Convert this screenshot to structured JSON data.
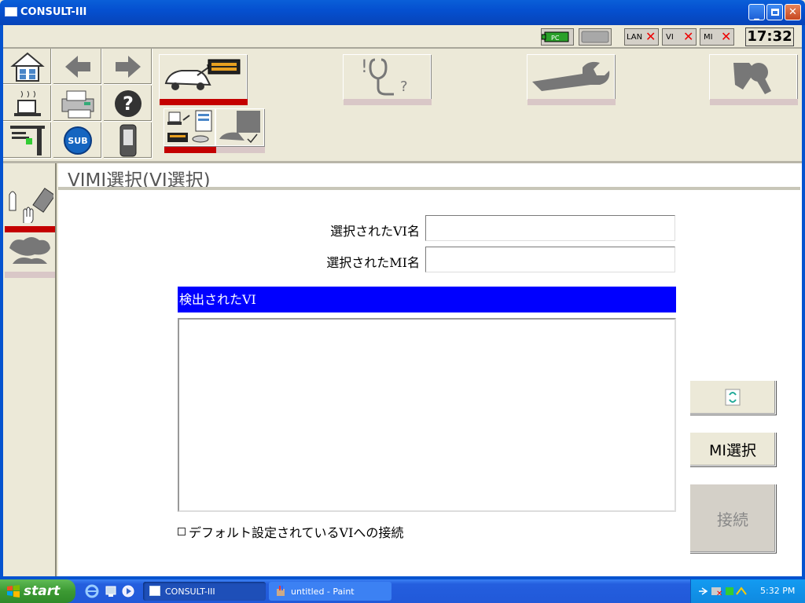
{
  "window": {
    "title": "CONSULT-III"
  },
  "status": {
    "pc_label": "PC",
    "lan_label": "LAN",
    "vi_label": "VI",
    "mi_label": "MI",
    "clock": "17:32"
  },
  "page": {
    "title": "VIMI選択(VI選択)",
    "selected_vi_label": "選択されたVI名",
    "selected_mi_label": "選択されたMI名",
    "selected_vi_value": "",
    "selected_mi_value": "",
    "detected_header": "検出されたVI",
    "default_connect_label": "デフォルト設定されているVIへの接続",
    "mi_select_button": "MI選択",
    "connect_button": "接続"
  },
  "nav": {
    "sub_label": "SUB",
    "help_label": "?"
  },
  "taskbar": {
    "start_label": "start",
    "tasks": [
      {
        "label": "CONSULT-III"
      },
      {
        "label": "untitled - Paint"
      }
    ],
    "time": "5:32 PM"
  },
  "colors": {
    "header_blue": "#0000ff",
    "active_tab_red": "#c40000",
    "xp_blue": "#0553cf"
  }
}
